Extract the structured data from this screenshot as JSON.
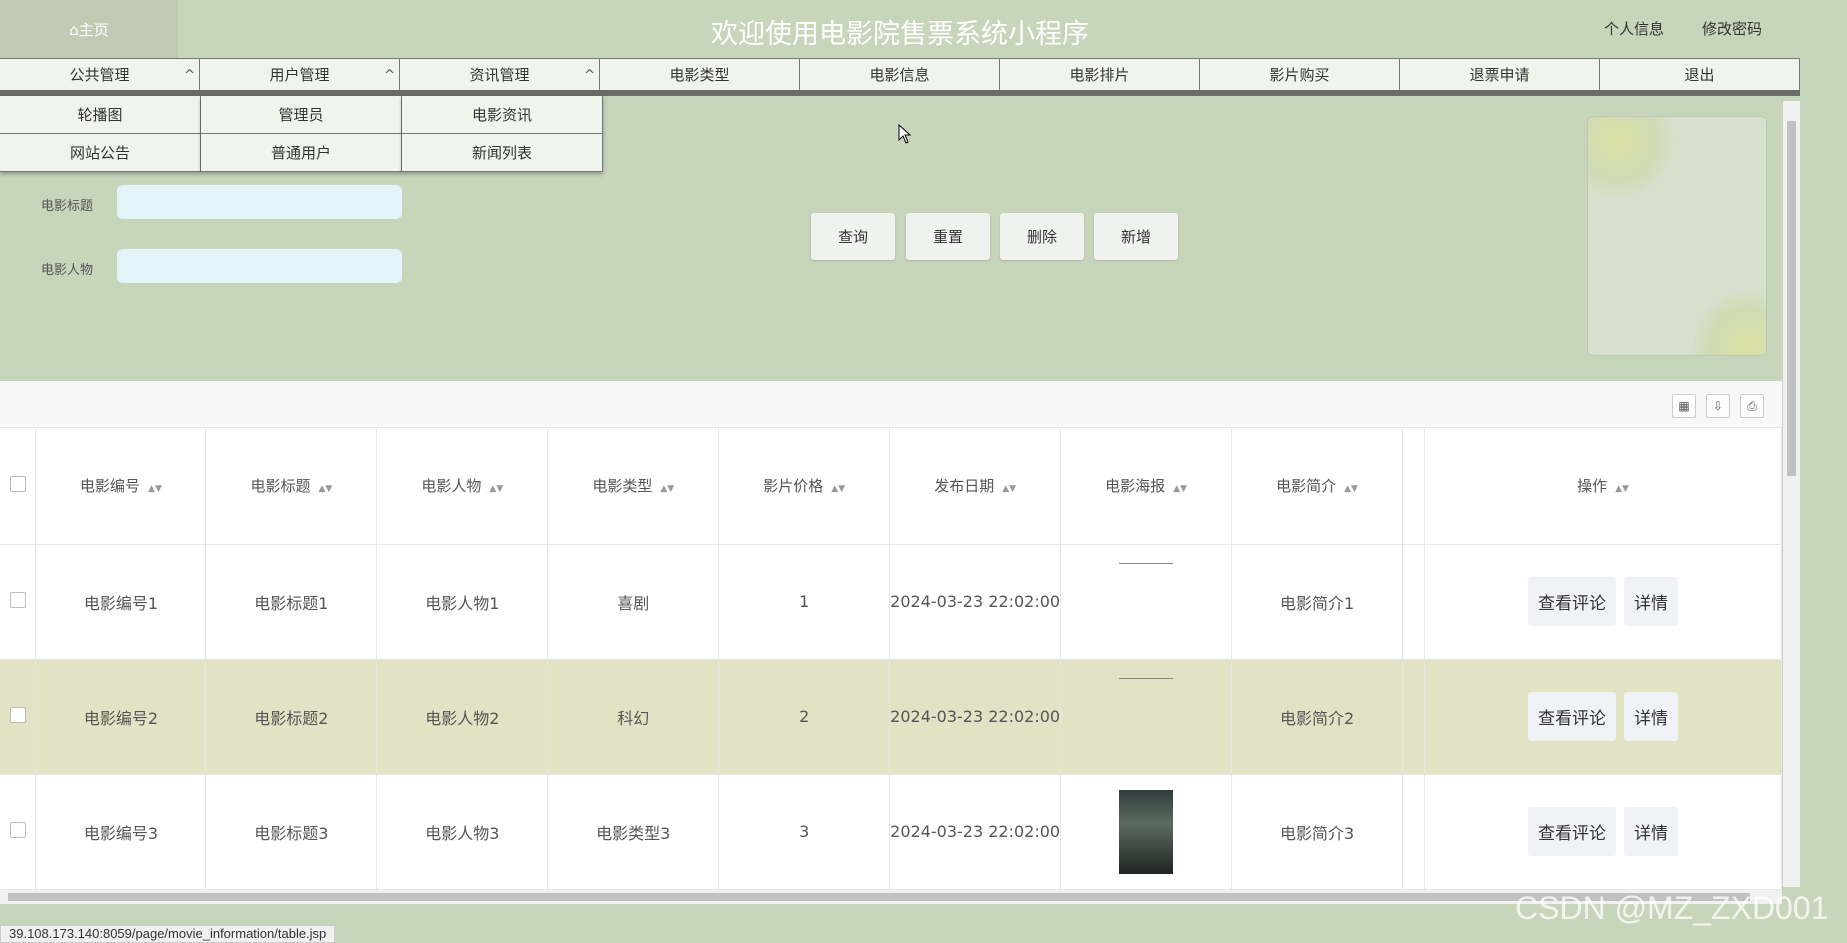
{
  "header": {
    "home": "⌂主页",
    "title": "欢迎使用电影院售票系统小程序",
    "profile": "个人信息",
    "change_password": "修改密码"
  },
  "nav": [
    {
      "label": "公共管理",
      "caret": "^"
    },
    {
      "label": "用户管理",
      "caret": "^"
    },
    {
      "label": "资讯管理",
      "caret": "^"
    },
    {
      "label": "电影类型"
    },
    {
      "label": "电影信息"
    },
    {
      "label": "电影排片"
    },
    {
      "label": "影片购买"
    },
    {
      "label": "退票申请"
    },
    {
      "label": "退出"
    }
  ],
  "dropdowns": [
    [
      "轮播图",
      "网站公告"
    ],
    [
      "管理员",
      "普通用户"
    ],
    [
      "电影资讯",
      "新闻列表"
    ]
  ],
  "search": {
    "title_label": "电影标题",
    "person_label": "电影人物",
    "query": "查询",
    "reset": "重置",
    "delete": "删除",
    "add": "新增"
  },
  "table": {
    "headers": [
      "电影编号",
      "电影标题",
      "电影人物",
      "电影类型",
      "影片价格",
      "发布日期",
      "电影海报",
      "电影简介",
      "操作"
    ],
    "rows": [
      {
        "id": "电影编号1",
        "title": "电影标题1",
        "person": "电影人物1",
        "type": "喜剧",
        "price": "1",
        "date": "2024-03-23 22:02:00",
        "intro": "电影简介1"
      },
      {
        "id": "电影编号2",
        "title": "电影标题2",
        "person": "电影人物2",
        "type": "科幻",
        "price": "2",
        "date": "2024-03-23 22:02:00",
        "intro": "电影简介2"
      },
      {
        "id": "电影编号3",
        "title": "电影标题3",
        "person": "电影人物3",
        "type": "电影类型3",
        "price": "3",
        "date": "2024-03-23 22:02:00",
        "intro": "电影简介3"
      }
    ],
    "view_comments": "查看评论",
    "details": "详情"
  },
  "status_url": "39.108.173.140:8059/page/movie_information/table.jsp",
  "watermark": "CSDN @MZ_ZXD001"
}
